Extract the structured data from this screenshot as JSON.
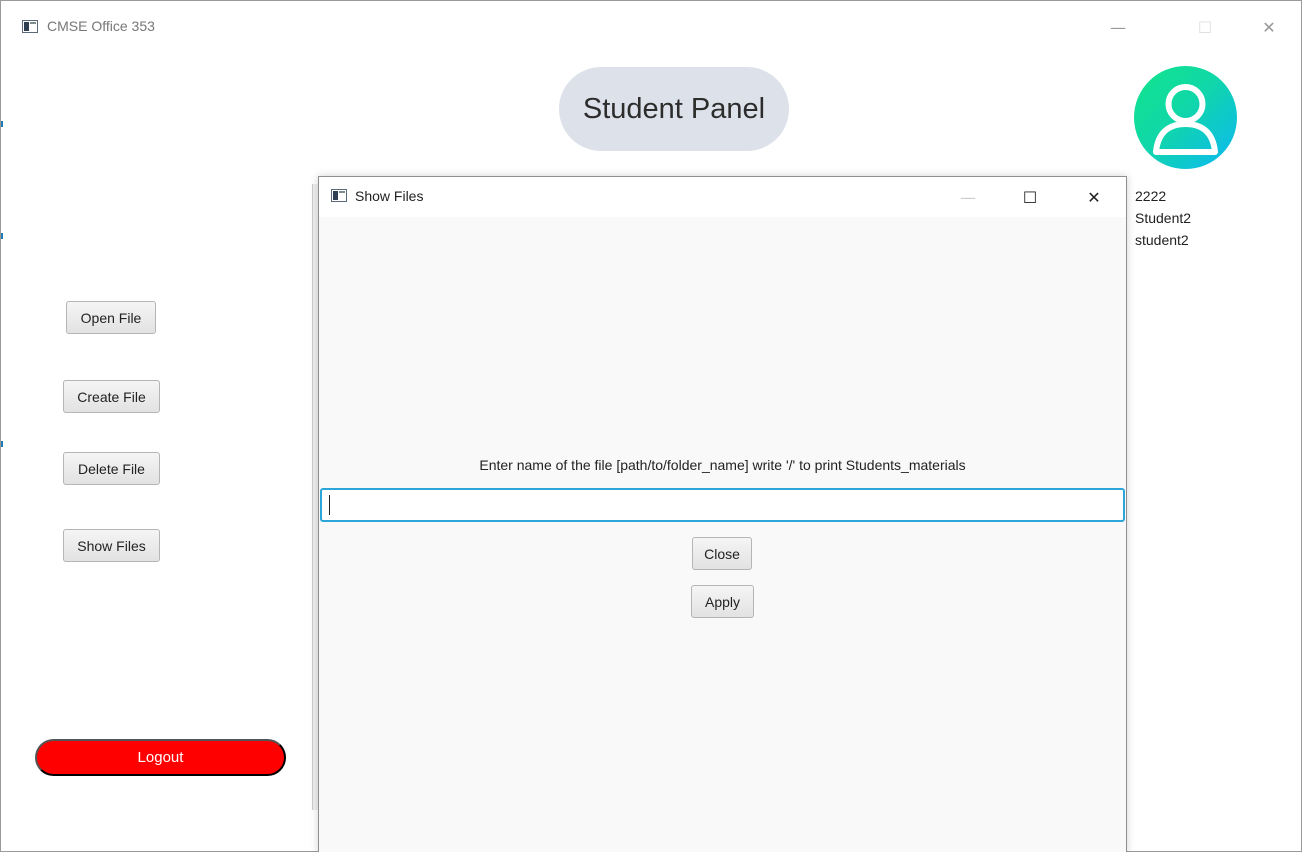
{
  "main_window": {
    "title": "CMSE Office 353",
    "minimize_glyph": "—",
    "maximize_glyph": "☐",
    "close_glyph": "✕"
  },
  "header": {
    "panel_title": "Student Panel"
  },
  "user": {
    "id": "2222",
    "name": "Student2",
    "username": "student2",
    "avatar_icon": "user-icon"
  },
  "sidebar": {
    "open_file": "Open File",
    "create_file": "Create File",
    "delete_file": "Delete File",
    "show_files": "Show Files",
    "logout": "Logout"
  },
  "dialog": {
    "title": "Show Files",
    "minimize_glyph": "—",
    "maximize_glyph": "☐",
    "close_glyph": "✕",
    "prompt": "Enter name of the file [path/to/folder_name] write '/' to print Students_materials",
    "input_value": "",
    "close_label": "Close",
    "apply_label": "Apply"
  },
  "colors": {
    "logout_bg": "#ff0000",
    "pill_bg": "#dde2ea",
    "avatar_gradient_start": "#12e58a",
    "avatar_gradient_end": "#0cb7f5",
    "input_focus": "#2ea5d8"
  }
}
